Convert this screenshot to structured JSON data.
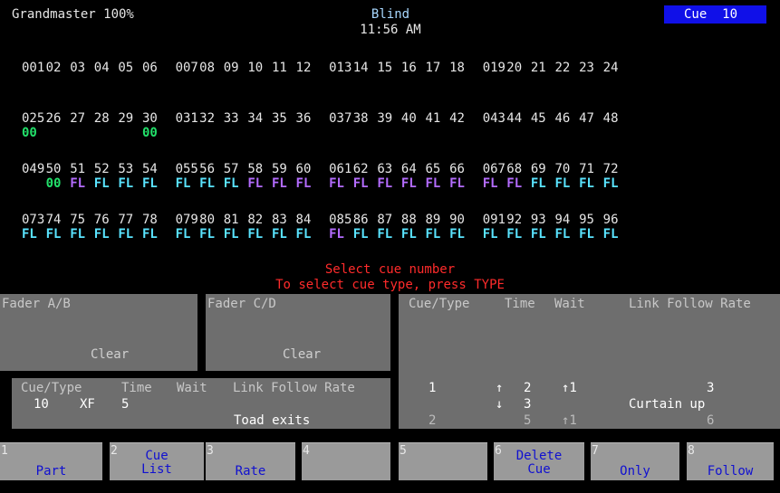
{
  "header": {
    "grandmaster": "Grandmaster 100%",
    "mode": "Blind",
    "time": "11:56 AM",
    "cue": "Cue  10"
  },
  "channel_rows": [
    [
      [
        {
          "n": "001",
          "l": ""
        },
        {
          "n": "02",
          "l": ""
        },
        {
          "n": "03",
          "l": ""
        },
        {
          "n": "04",
          "l": ""
        },
        {
          "n": "05",
          "l": ""
        },
        {
          "n": "06",
          "l": ""
        }
      ],
      [
        {
          "n": "007",
          "l": ""
        },
        {
          "n": "08",
          "l": ""
        },
        {
          "n": "09",
          "l": ""
        },
        {
          "n": "10",
          "l": ""
        },
        {
          "n": "11",
          "l": ""
        },
        {
          "n": "12",
          "l": ""
        }
      ],
      [
        {
          "n": "013",
          "l": ""
        },
        {
          "n": "14",
          "l": ""
        },
        {
          "n": "15",
          "l": ""
        },
        {
          "n": "16",
          "l": ""
        },
        {
          "n": "17",
          "l": ""
        },
        {
          "n": "18",
          "l": ""
        }
      ],
      [
        {
          "n": "019",
          "l": ""
        },
        {
          "n": "20",
          "l": ""
        },
        {
          "n": "21",
          "l": ""
        },
        {
          "n": "22",
          "l": ""
        },
        {
          "n": "23",
          "l": ""
        },
        {
          "n": "24",
          "l": ""
        }
      ]
    ],
    [
      [
        {
          "n": "025",
          "l": "00",
          "c": "00"
        },
        {
          "n": "26",
          "l": ""
        },
        {
          "n": "27",
          "l": ""
        },
        {
          "n": "28",
          "l": ""
        },
        {
          "n": "29",
          "l": ""
        },
        {
          "n": "30",
          "l": "00",
          "c": "00"
        }
      ],
      [
        {
          "n": "031",
          "l": ""
        },
        {
          "n": "32",
          "l": ""
        },
        {
          "n": "33",
          "l": ""
        },
        {
          "n": "34",
          "l": ""
        },
        {
          "n": "35",
          "l": ""
        },
        {
          "n": "36",
          "l": ""
        }
      ],
      [
        {
          "n": "037",
          "l": ""
        },
        {
          "n": "38",
          "l": ""
        },
        {
          "n": "39",
          "l": ""
        },
        {
          "n": "40",
          "l": ""
        },
        {
          "n": "41",
          "l": ""
        },
        {
          "n": "42",
          "l": ""
        }
      ],
      [
        {
          "n": "043",
          "l": ""
        },
        {
          "n": "44",
          "l": ""
        },
        {
          "n": "45",
          "l": ""
        },
        {
          "n": "46",
          "l": ""
        },
        {
          "n": "47",
          "l": ""
        },
        {
          "n": "48",
          "l": ""
        }
      ]
    ],
    [
      [
        {
          "n": "049",
          "l": ""
        },
        {
          "n": "50",
          "l": "00",
          "c": "00"
        },
        {
          "n": "51",
          "l": "FL",
          "c": "p"
        },
        {
          "n": "52",
          "l": "FL",
          "c": "c"
        },
        {
          "n": "53",
          "l": "FL",
          "c": "c"
        },
        {
          "n": "54",
          "l": "FL",
          "c": "c"
        }
      ],
      [
        {
          "n": "055",
          "l": "FL",
          "c": "c"
        },
        {
          "n": "56",
          "l": "FL",
          "c": "c"
        },
        {
          "n": "57",
          "l": "FL",
          "c": "c"
        },
        {
          "n": "58",
          "l": "FL",
          "c": "p"
        },
        {
          "n": "59",
          "l": "FL",
          "c": "p"
        },
        {
          "n": "60",
          "l": "FL",
          "c": "p"
        }
      ],
      [
        {
          "n": "061",
          "l": "FL",
          "c": "p"
        },
        {
          "n": "62",
          "l": "FL",
          "c": "p"
        },
        {
          "n": "63",
          "l": "FL",
          "c": "p"
        },
        {
          "n": "64",
          "l": "FL",
          "c": "p"
        },
        {
          "n": "65",
          "l": "FL",
          "c": "p"
        },
        {
          "n": "66",
          "l": "FL",
          "c": "p"
        }
      ],
      [
        {
          "n": "067",
          "l": "FL",
          "c": "p"
        },
        {
          "n": "68",
          "l": "FL",
          "c": "p"
        },
        {
          "n": "69",
          "l": "FL",
          "c": "c"
        },
        {
          "n": "70",
          "l": "FL",
          "c": "c"
        },
        {
          "n": "71",
          "l": "FL",
          "c": "c"
        },
        {
          "n": "72",
          "l": "FL",
          "c": "c"
        }
      ]
    ],
    [
      [
        {
          "n": "073",
          "l": "FL",
          "c": "c"
        },
        {
          "n": "74",
          "l": "FL",
          "c": "c"
        },
        {
          "n": "75",
          "l": "FL",
          "c": "c"
        },
        {
          "n": "76",
          "l": "FL",
          "c": "c"
        },
        {
          "n": "77",
          "l": "FL",
          "c": "c"
        },
        {
          "n": "78",
          "l": "FL",
          "c": "c"
        }
      ],
      [
        {
          "n": "079",
          "l": "FL",
          "c": "c"
        },
        {
          "n": "80",
          "l": "FL",
          "c": "c"
        },
        {
          "n": "81",
          "l": "FL",
          "c": "c"
        },
        {
          "n": "82",
          "l": "FL",
          "c": "c"
        },
        {
          "n": "83",
          "l": "FL",
          "c": "c"
        },
        {
          "n": "84",
          "l": "FL",
          "c": "c"
        }
      ],
      [
        {
          "n": "085",
          "l": "FL",
          "c": "p"
        },
        {
          "n": "86",
          "l": "FL",
          "c": "c"
        },
        {
          "n": "87",
          "l": "FL",
          "c": "c"
        },
        {
          "n": "88",
          "l": "FL",
          "c": "c"
        },
        {
          "n": "89",
          "l": "FL",
          "c": "c"
        },
        {
          "n": "90",
          "l": "FL",
          "c": "c"
        }
      ],
      [
        {
          "n": "091",
          "l": "FL",
          "c": "c"
        },
        {
          "n": "92",
          "l": "FL",
          "c": "c"
        },
        {
          "n": "93",
          "l": "FL",
          "c": "c"
        },
        {
          "n": "94",
          "l": "FL",
          "c": "c"
        },
        {
          "n": "95",
          "l": "FL",
          "c": "c"
        },
        {
          "n": "96",
          "l": "FL",
          "c": "c"
        }
      ]
    ]
  ],
  "prompts": {
    "line1": "Select cue number",
    "line2": "To select cue type, press TYPE"
  },
  "fader_ab": {
    "title": "Fader A/B",
    "status": "Clear"
  },
  "fader_cd": {
    "title": "Fader C/D",
    "status": "Clear"
  },
  "cue_detail": {
    "headers": {
      "cue_type": "Cue/Type",
      "time": "Time",
      "wait": "Wait",
      "link_follow_rate": "Link Follow Rate"
    },
    "cue": "10",
    "type": "XF",
    "time": "5",
    "label": "Toad exits"
  },
  "cue_list": {
    "headers": {
      "cue_type": "Cue/Type",
      "time": "Time",
      "wait": "Wait",
      "link_follow_rate": "Link Follow Rate"
    },
    "row1": {
      "cue": "1",
      "up": "↑",
      "time_up": "2",
      "wait": "↑1",
      "link": "3"
    },
    "row2": {
      "down": "↓",
      "time_down": "3",
      "label": "Curtain up"
    },
    "row3": {
      "cue": "2",
      "time": "5",
      "wait": "↑1",
      "link": "6"
    }
  },
  "softkeys": [
    {
      "num": "1",
      "label": "Part"
    },
    {
      "num": "2",
      "label": "Cue\nList"
    },
    {
      "num": "3",
      "label": "Rate"
    },
    {
      "num": "4",
      "label": ""
    },
    {
      "num": "5",
      "label": ""
    },
    {
      "num": "6",
      "label": "Delete\nCue"
    },
    {
      "num": "7",
      "label": "Only"
    },
    {
      "num": "8",
      "label": "Follow"
    }
  ],
  "colors": {
    "level_green": "#22e06a",
    "level_cyan": "#5ae4ff",
    "level_purple": "#b46cff",
    "prompt_red": "#ff2b2b",
    "cue_badge_blue": "#1010e8",
    "softkey_label_blue": "#1010d0"
  }
}
